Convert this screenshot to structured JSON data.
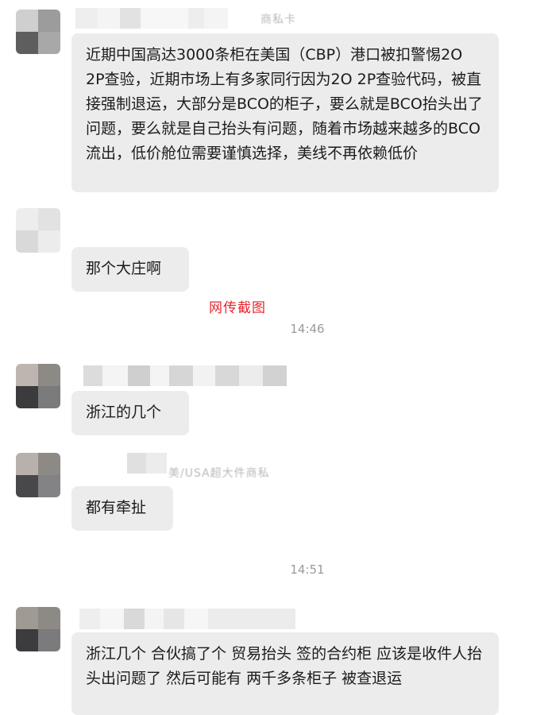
{
  "messages": [
    {
      "sender_fragment": "商私卡",
      "text": "近期中国高达3000条柜在美国（CBP）港口被扣警惕2O 2P查验，近期市场上有多家同行因为2O 2P查验代码，被直接强制退运，大部分是BCO的柜子，要么就是BCO抬头出了问题，要么就是自己抬头有问题，随着市场越来越多的BCO流出，低价舱位需要谨慎选择，美线不再依赖低价"
    },
    {
      "text": "那个大庄啊"
    },
    {
      "text": "浙江的几个"
    },
    {
      "sender_fragment": "美/USA超大件商私",
      "text": "都有牵扯"
    },
    {
      "text": "浙江几个 合伙搞了个 贸易抬头 签的合约柜 应该是收件人抬头出问题了 然后可能有 两千多条柜子 被查退运"
    }
  ],
  "watermark": "网传截图",
  "timestamps": [
    "14:46",
    "14:51"
  ],
  "colors": {
    "bubble": "#ececec",
    "watermark": "#e4262d",
    "timestamp": "#9a9a9a"
  }
}
